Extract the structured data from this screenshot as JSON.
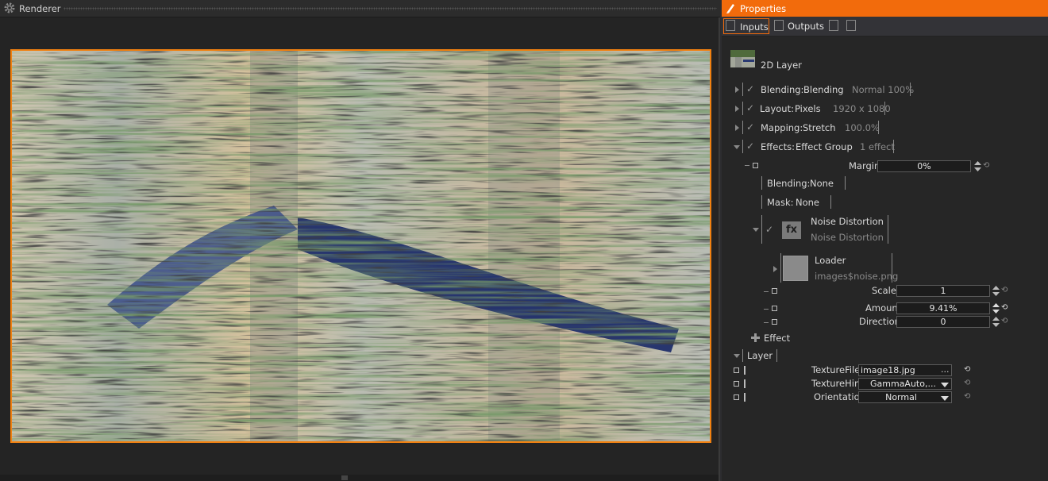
{
  "renderer": {
    "title": "Renderer",
    "gear_icon": "gear-icon"
  },
  "properties": {
    "title": "Properties",
    "tabs": {
      "inputs": "Inputs",
      "outputs": "Outputs"
    },
    "layer_name": "2D Layer",
    "rows": {
      "blending": {
        "label": "Blending:",
        "value": "Blending",
        "extra": "Normal 100%"
      },
      "layout": {
        "label": "Layout:",
        "value": "Pixels",
        "extra": "1920 x 1080"
      },
      "mapping": {
        "label": "Mapping:",
        "value": "Stretch",
        "extra": "100.0%"
      },
      "effects": {
        "label": "Effects:",
        "value": "Effect Group",
        "extra": "1 effect"
      }
    },
    "margin": {
      "label": "Margin",
      "value": "0%"
    },
    "sub_blending": {
      "label": "Blending:",
      "value": "None"
    },
    "mask": {
      "label": "Mask:",
      "value": "None"
    },
    "noise": {
      "icon": "fx",
      "title": "Noise Distortion",
      "subtitle": "Noise Distortion"
    },
    "loader": {
      "title": "Loader",
      "path": "images$noise.png"
    },
    "scale": {
      "label": "Scale",
      "value": "1"
    },
    "amount": {
      "label": "Amount",
      "value": "9.41%"
    },
    "direction": {
      "label": "Direction",
      "value": "0"
    },
    "add_effect": "Effect",
    "layer_section": "Layer",
    "texture_file": {
      "label": "TextureFile",
      "value": "image18.jpg",
      "browse": "..."
    },
    "texture_hint": {
      "label": "TextureHint",
      "value": "GammaAuto,..."
    },
    "orientation": {
      "label": "Orientation",
      "value": "Normal"
    }
  },
  "colors": {
    "accent": "#f26b0c"
  }
}
